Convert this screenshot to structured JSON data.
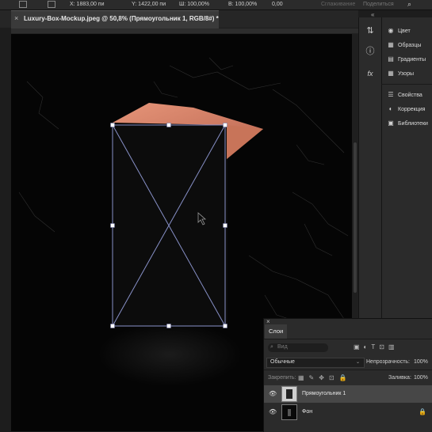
{
  "options_bar": {
    "x": "X: 1883,00 пи",
    "y": "Y: 1422,00 пи",
    "w": "Ш: 100,00%",
    "h": "В: 100,00%",
    "angle": "0,00",
    "smooth": "Сглаживание",
    "share": "Поделиться"
  },
  "document": {
    "tab_title": "Luxury-Box-Mockup.jpeg @ 50,8% (Прямоугольник 1, RGB/8#) *",
    "close_glyph": "×"
  },
  "right_panel": {
    "items": [
      {
        "label": "Цвет",
        "icon": "palette-icon",
        "glyph": "◉"
      },
      {
        "label": "Образцы",
        "icon": "swatches-icon",
        "glyph": "▦"
      },
      {
        "label": "Градиенты",
        "icon": "gradient-icon",
        "glyph": "▤"
      },
      {
        "label": "Узоры",
        "icon": "patterns-icon",
        "glyph": "▦"
      },
      {
        "label": "Свойства",
        "icon": "properties-icon",
        "glyph": "☰"
      },
      {
        "label": "Коррекция",
        "icon": "adjustments-icon",
        "glyph": "◐"
      },
      {
        "label": "Библиотеки",
        "icon": "libraries-icon",
        "glyph": "▣"
      }
    ]
  },
  "layers_panel": {
    "tab_label": "Слои",
    "search_placeholder": "Вид",
    "blend_mode": "Обычные",
    "opacity_label": "Непрозрачность:",
    "opacity_value": "100%",
    "lock_label": "Закрепить:",
    "fill_label": "Заливка:",
    "fill_value": "100%",
    "layers": [
      {
        "name": "Прямоугольник 1",
        "selected": true
      },
      {
        "name": "Фон",
        "selected": false
      }
    ]
  },
  "colors": {
    "box_accent": "#d9846b",
    "transform_line": "#8891c8"
  }
}
